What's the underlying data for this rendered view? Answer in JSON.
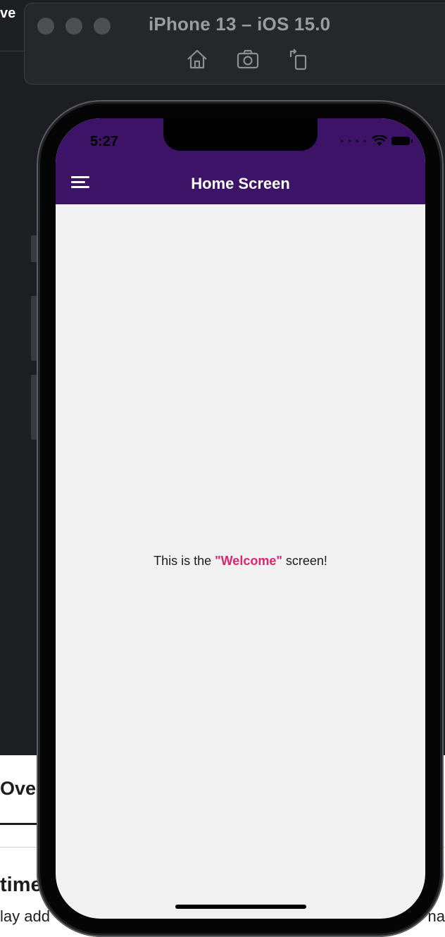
{
  "background": {
    "top_text": "ve",
    "doc_heading": "Ove",
    "doc_subheading": "time",
    "doc_body_left": "lay add",
    "doc_body_right": "na"
  },
  "simulator": {
    "title": "iPhone 13 – iOS 15.0",
    "toolbar": {
      "icons": [
        "home-icon",
        "screenshot-icon",
        "rotate-icon"
      ]
    }
  },
  "device": {
    "status_bar": {
      "time": "5:27"
    },
    "nav_header": {
      "title": "Home Screen",
      "background": "#3d1368"
    },
    "content": {
      "message_prefix": "This is the ",
      "message_highlight": "\"Welcome\"",
      "message_suffix": " screen!",
      "highlight_color": "#e0246f"
    }
  }
}
